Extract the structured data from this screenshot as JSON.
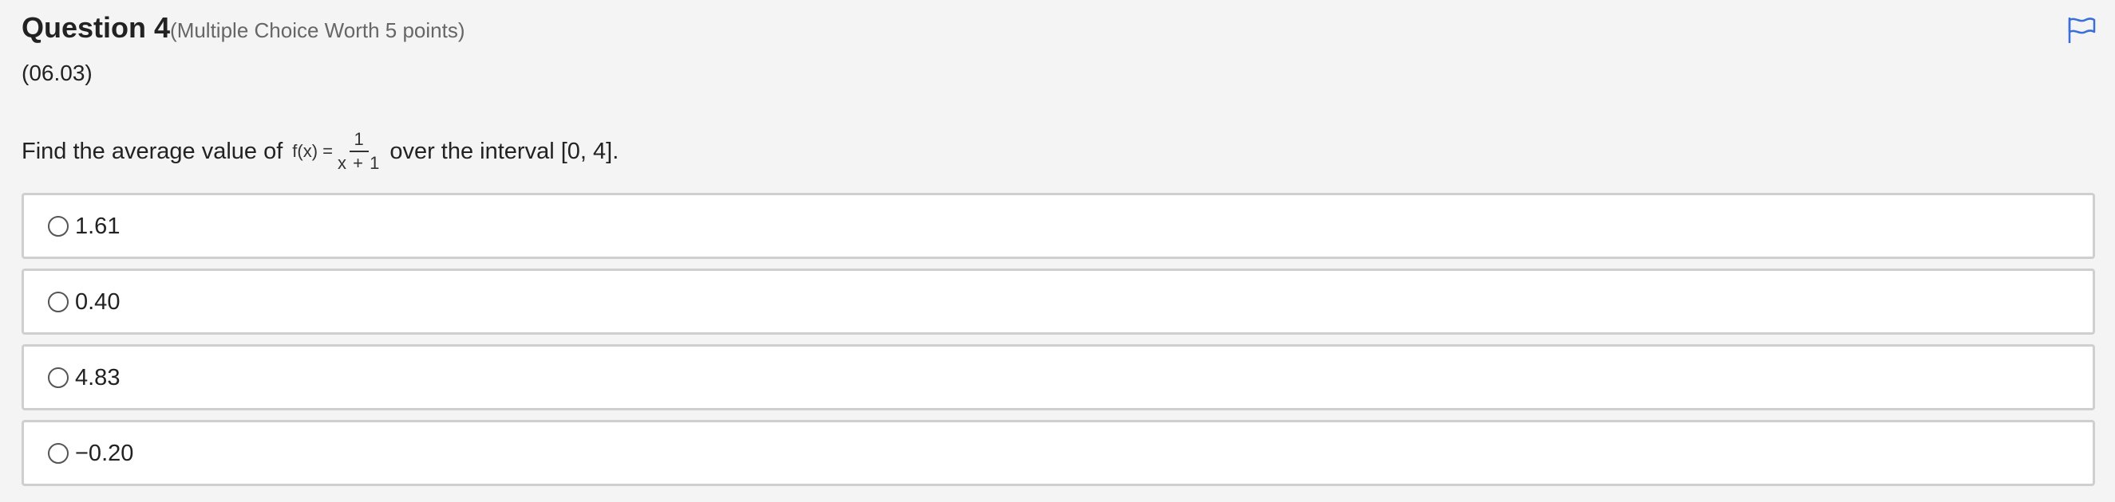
{
  "question": {
    "title": "Question 4",
    "meta": "(Multiple Choice Worth 5 points)",
    "code": "(06.03)",
    "prompt_before": "Find the average value of",
    "function_lhs": "f(x) =",
    "function_numerator": "1",
    "function_denominator": "x + 1",
    "prompt_after": "over the interval [0, 4].",
    "flag_icon": "flag-icon",
    "accent_color": "#3a6fd8"
  },
  "options": [
    {
      "label": "1.61"
    },
    {
      "label": "0.40"
    },
    {
      "label": "4.83"
    },
    {
      "label": "−0.20"
    }
  ]
}
